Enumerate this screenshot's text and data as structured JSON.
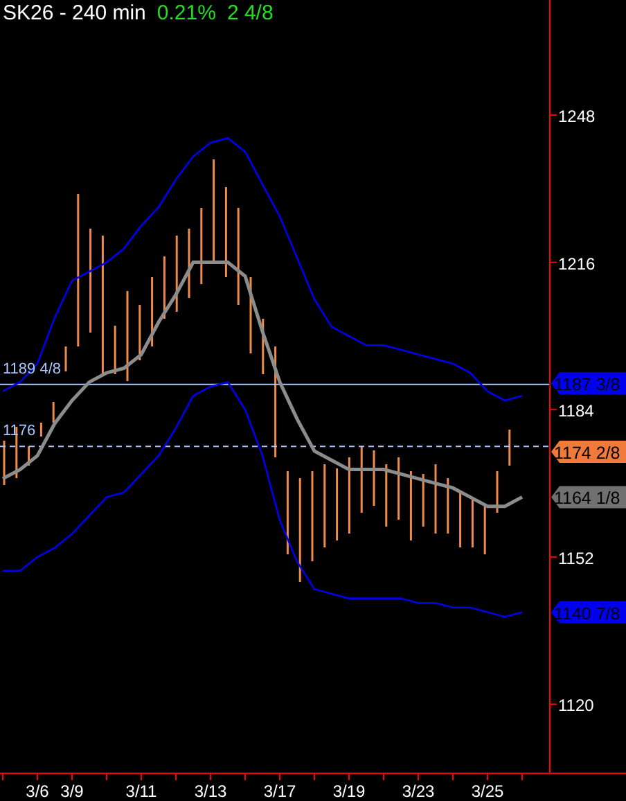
{
  "header": {
    "symbol": "SK26 - 240 min",
    "change": "0.21%",
    "net": "2 4/8"
  },
  "chart": {
    "chart_data": {
      "type": "line",
      "categories": [
        null,
        null,
        "3/6",
        null,
        "3/9",
        null,
        null,
        null,
        "3/11",
        null,
        null,
        null,
        "3/13",
        null,
        null,
        null,
        "3/17",
        null,
        null,
        null,
        "3/19",
        null,
        null,
        null,
        "3/23",
        null,
        null,
        null,
        "3/25",
        null,
        null
      ],
      "yticks": [
        1248,
        1216,
        1184,
        1152,
        1120
      ],
      "ylim": [
        1105,
        1273
      ],
      "series": [
        {
          "color": "#0000ee",
          "values": [
            1188,
            1190,
            1194,
            1204,
            1212,
            1214,
            1216,
            1219,
            1224,
            1228,
            1234,
            1239,
            1242,
            1243,
            1240,
            1233,
            1226,
            1217,
            1208,
            1202,
            1200,
            1198,
            1198,
            1197,
            1196,
            1195,
            1194,
            1192,
            1188,
            1186,
            1187
          ]
        },
        {
          "color": "#8c8c8c",
          "values": [
            1169,
            1171,
            1174,
            1181,
            1186,
            1190,
            1192,
            1193,
            1196,
            1203,
            1209,
            1216,
            1216,
            1216,
            1213,
            1201,
            1190,
            1182,
            1175,
            1173,
            1171,
            1171,
            1171,
            1170,
            1169,
            1168,
            1167,
            1165,
            1163,
            1163,
            1165
          ]
        },
        {
          "color": "#0000ee",
          "values": [
            1149,
            1149,
            1152,
            1154,
            1157,
            1161,
            1165,
            1166,
            1170,
            1174,
            1180,
            1187,
            1189,
            1190,
            1184,
            1174,
            1160,
            1151,
            1145,
            1144,
            1143,
            1143,
            1143,
            1143,
            1142,
            1142,
            1141,
            1141,
            1140,
            1139,
            1140
          ]
        }
      ],
      "ref_lines": [
        {
          "axis": "y",
          "value": 1189.5,
          "label": "1189 4/8",
          "color": "#a8c8ff"
        },
        {
          "axis": "y",
          "value": 1176,
          "label": "1176",
          "color": "#a8c8ff"
        }
      ]
    },
    "price_tags": [
      {
        "kind": "upper",
        "label": "1187 3/8",
        "color": "#0000ee"
      },
      {
        "kind": "price",
        "label": "1174 2/8",
        "color": "#f07a3a"
      },
      {
        "kind": "average",
        "label": "1164 1/8",
        "color": "#707070"
      },
      {
        "kind": "lower",
        "label": "1140 7/8",
        "color": "#0000ee"
      }
    ]
  }
}
